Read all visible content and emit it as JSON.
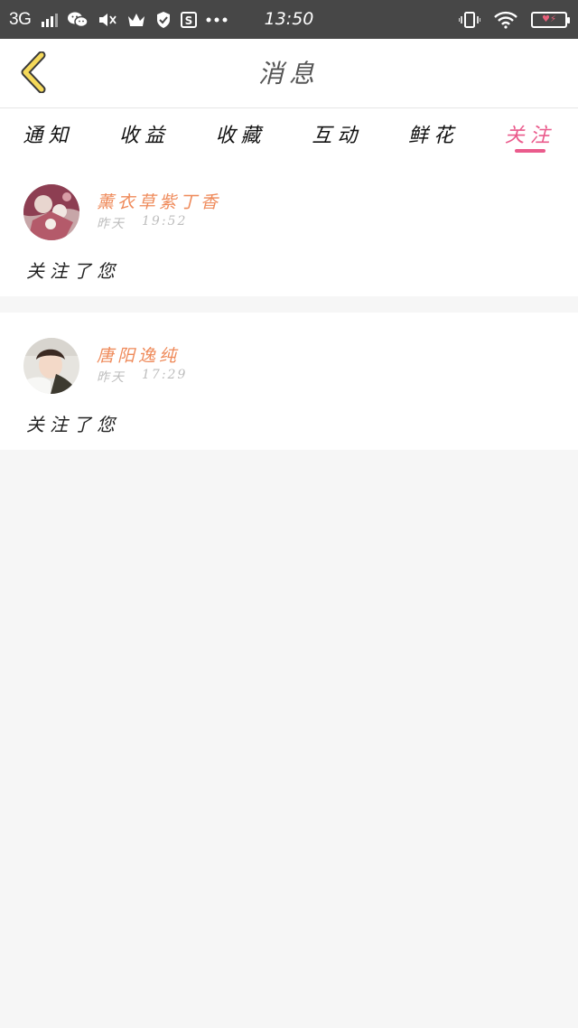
{
  "status_bar": {
    "network": "3G",
    "time": "13:50",
    "icons": [
      "signal-icon",
      "wechat-icon",
      "mute-icon",
      "crown-icon",
      "shield-icon",
      "s-app-icon",
      "more-dots-icon",
      "vibrate-icon",
      "wifi-icon",
      "battery-icon"
    ],
    "battery_color": "#e8607a"
  },
  "header": {
    "back_icon": "chevron-left-icon",
    "title": "消息"
  },
  "tabs": [
    {
      "label": "通知"
    },
    {
      "label": "收益"
    },
    {
      "label": "收藏"
    },
    {
      "label": "互动"
    },
    {
      "label": "鲜花"
    },
    {
      "label": "关注",
      "active": true
    }
  ],
  "accent_color": "#ea5b8c",
  "name_color": "#ef8a5a",
  "messages": [
    {
      "user_name": "薰衣草紫丁香",
      "day": "昨天",
      "time": "19:52",
      "text": "关注了您"
    },
    {
      "user_name": "唐阳逸纯",
      "day": "昨天",
      "time": "17:29",
      "text": "关注了您"
    }
  ]
}
